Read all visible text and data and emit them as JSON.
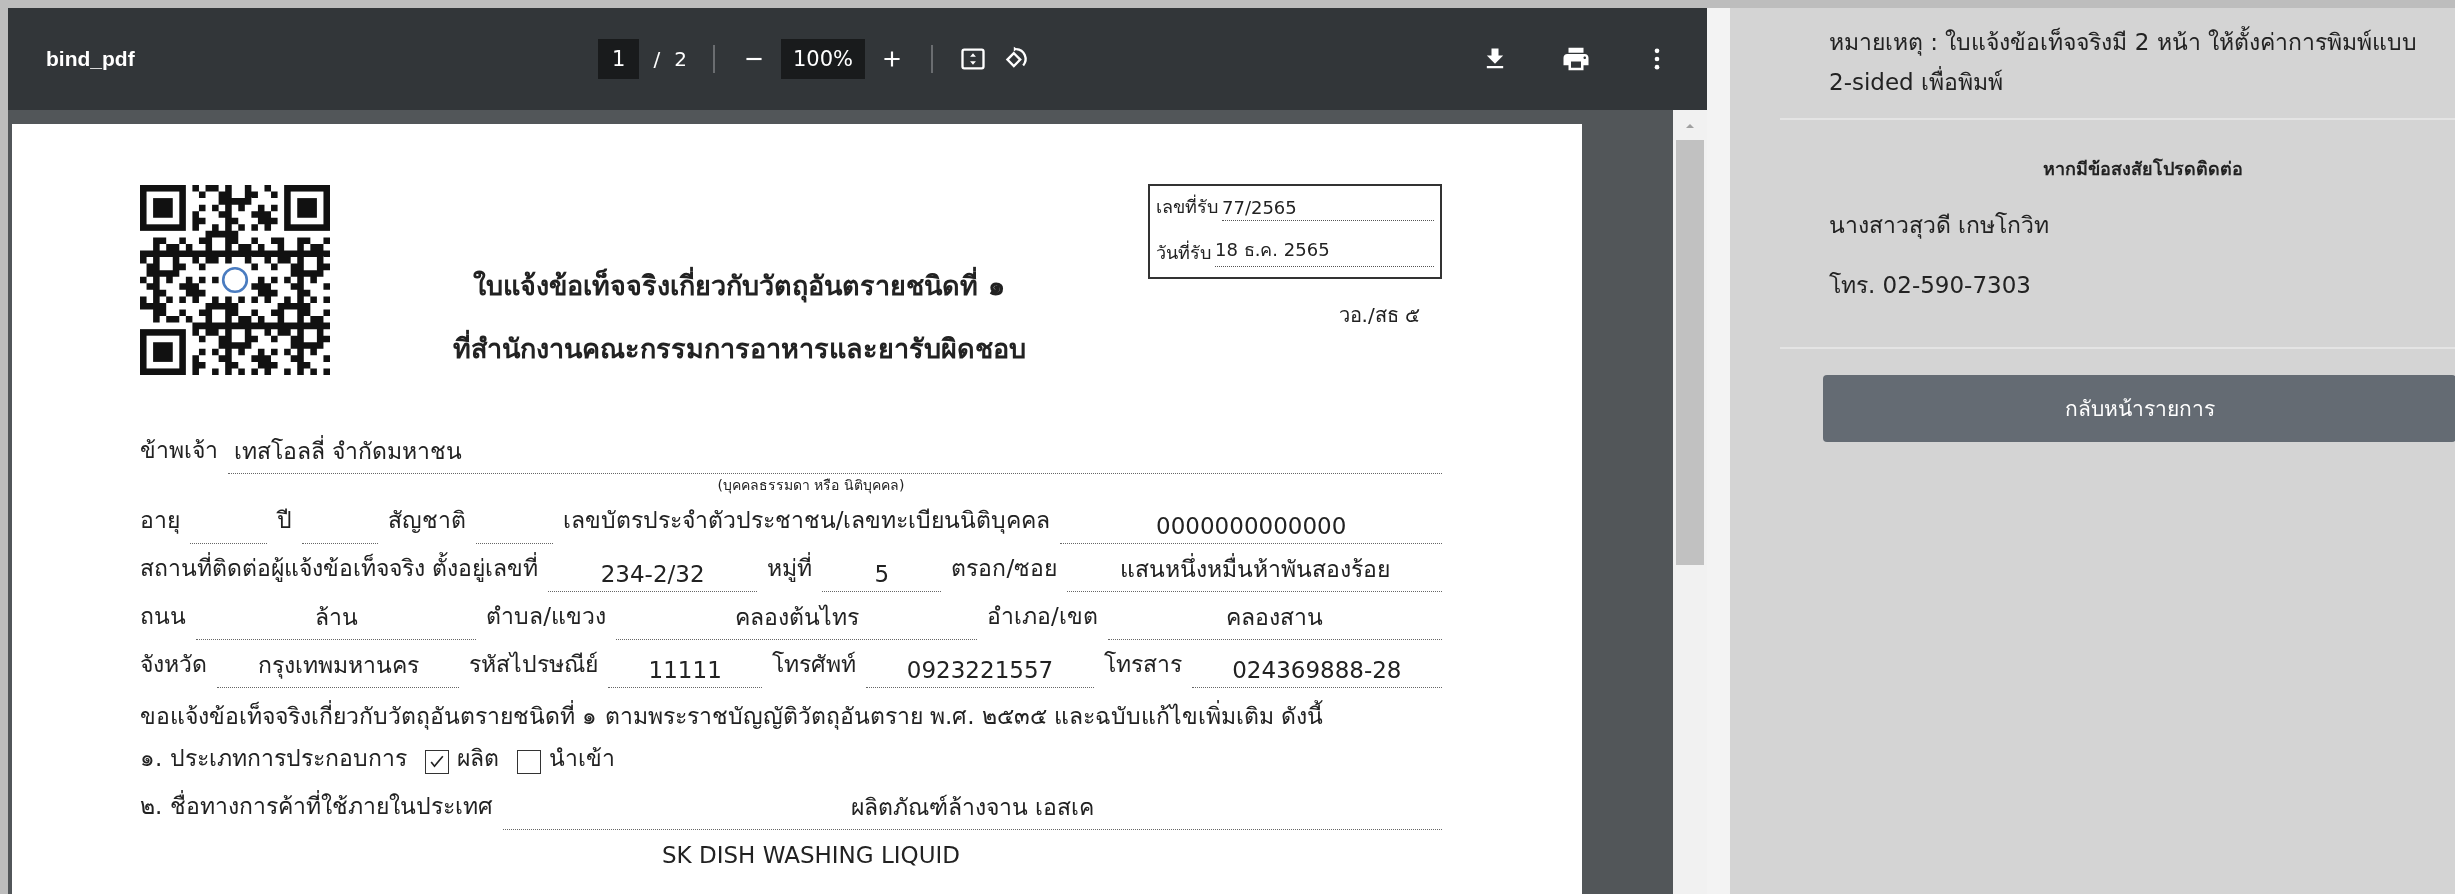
{
  "viewer": {
    "title": "bind_pdf",
    "page": {
      "current": "1",
      "separator": "/",
      "total": "2"
    },
    "zoom": "100%"
  },
  "document": {
    "receipt": [
      {
        "label": "เลขที่รับ",
        "value": "77/2565"
      },
      {
        "label": "วันที่รับ",
        "value": "18 ธ.ค. 2565"
      }
    ],
    "form_code": "วอ./สธ ๕",
    "title_lines": [
      "ใบแจ้งข้อเท็จจริงเกี่ยวกับวัตถุอันตรายชนิดที่ ๑",
      "ที่สำนักงานคณะกรรมการอาหารและยารับผิดชอบ"
    ],
    "rows": [
      {
        "kind": "fields",
        "items": [
          {
            "kind": "label",
            "text": "ข้าพเจ้า"
          },
          {
            "kind": "value",
            "text": "เทสโอลลี่ จำกัดมหาชน"
          }
        ]
      },
      {
        "kind": "caption",
        "text": "(บุคคลธรรมดา หรือ นิติบุคคล)"
      },
      {
        "kind": "fields",
        "items": [
          {
            "kind": "label",
            "text": "อายุ"
          },
          {
            "kind": "blank"
          },
          {
            "kind": "label",
            "text": "ปี"
          },
          {
            "kind": "blank"
          },
          {
            "kind": "label",
            "text": "สัญชาติ"
          },
          {
            "kind": "blank"
          },
          {
            "kind": "label",
            "text": "เลขบัตรประจำตัวประชาชน/เลขทะเบียนนิติบุคคล"
          },
          {
            "kind": "value",
            "text": "0000000000000"
          }
        ]
      },
      {
        "kind": "fields",
        "items": [
          {
            "kind": "label",
            "text": "สถานที่ติดต่อผู้แจ้งข้อเท็จจริง ตั้งอยู่เลขที่"
          },
          {
            "kind": "value",
            "text": "234-2/32"
          },
          {
            "kind": "label",
            "text": "หมู่ที่"
          },
          {
            "kind": "value",
            "text": "5"
          },
          {
            "kind": "label",
            "text": "ตรอก/ซอย"
          },
          {
            "kind": "value",
            "text": "แสนหนึ่งหมื่นห้าพันสองร้อย"
          }
        ]
      },
      {
        "kind": "fields",
        "items": [
          {
            "kind": "label",
            "text": "ถนน"
          },
          {
            "kind": "value",
            "text": "ล้าน"
          },
          {
            "kind": "label",
            "text": "ตำบล/แขวง"
          },
          {
            "kind": "value",
            "text": "คลองต้นไทร"
          },
          {
            "kind": "label",
            "text": "อำเภอ/เขต"
          },
          {
            "kind": "value",
            "text": "คลองสาน"
          }
        ]
      },
      {
        "kind": "fields",
        "items": [
          {
            "kind": "label",
            "text": "จังหวัด"
          },
          {
            "kind": "value",
            "text": "กรุงเทพมหานคร"
          },
          {
            "kind": "label",
            "text": "รหัสไปรษณีย์"
          },
          {
            "kind": "value",
            "text": "11111"
          },
          {
            "kind": "label",
            "text": "โทรศัพท์"
          },
          {
            "kind": "value",
            "text": "0923221557"
          },
          {
            "kind": "label",
            "text": "โทรสาร"
          },
          {
            "kind": "value",
            "text": "024369888-28"
          }
        ]
      },
      {
        "kind": "text",
        "text": "ขอแจ้งข้อเท็จจริงเกี่ยวกับวัตถุอันตรายชนิดที่ ๑ ตามพระราชบัญญัติวัตถุอันตราย พ.ศ. ๒๕๓๕ และฉบับแก้ไขเพิ่มเติม ดังนี้"
      },
      {
        "kind": "fields",
        "items": [
          {
            "kind": "label",
            "text": "๑. ประเภทการประกอบการ"
          },
          {
            "kind": "checkbox",
            "text": "ผลิต",
            "checked": true
          },
          {
            "kind": "checkbox",
            "text": "นำเข้า",
            "checked": false
          }
        ]
      },
      {
        "kind": "fields",
        "items": [
          {
            "kind": "label",
            "text": "๒. ชื่อทางการค้าที่ใช้ภายในประเทศ"
          },
          {
            "kind": "value",
            "text": "ผลิตภัณฑ์ล้างจาน เอสเค"
          }
        ]
      },
      {
        "kind": "continuation",
        "text": "SK DISH WASHING LIQUID"
      }
    ]
  },
  "side_panel": {
    "note": "หมายเหตุ : ใบแจ้งข้อเท็จจริงมี 2 หน้า ให้ตั้งค่าการพิมพ์แบบ 2-sided เพื่อพิมพ์",
    "contact_heading": "หากมีข้อสงสัยโปรดติดต่อ",
    "contact_name": "นางสาวสุวดี เกษโกวิท",
    "contact_phone": "โทร. 02-590-7303",
    "back_button": "กลับหน้ารายการ"
  }
}
